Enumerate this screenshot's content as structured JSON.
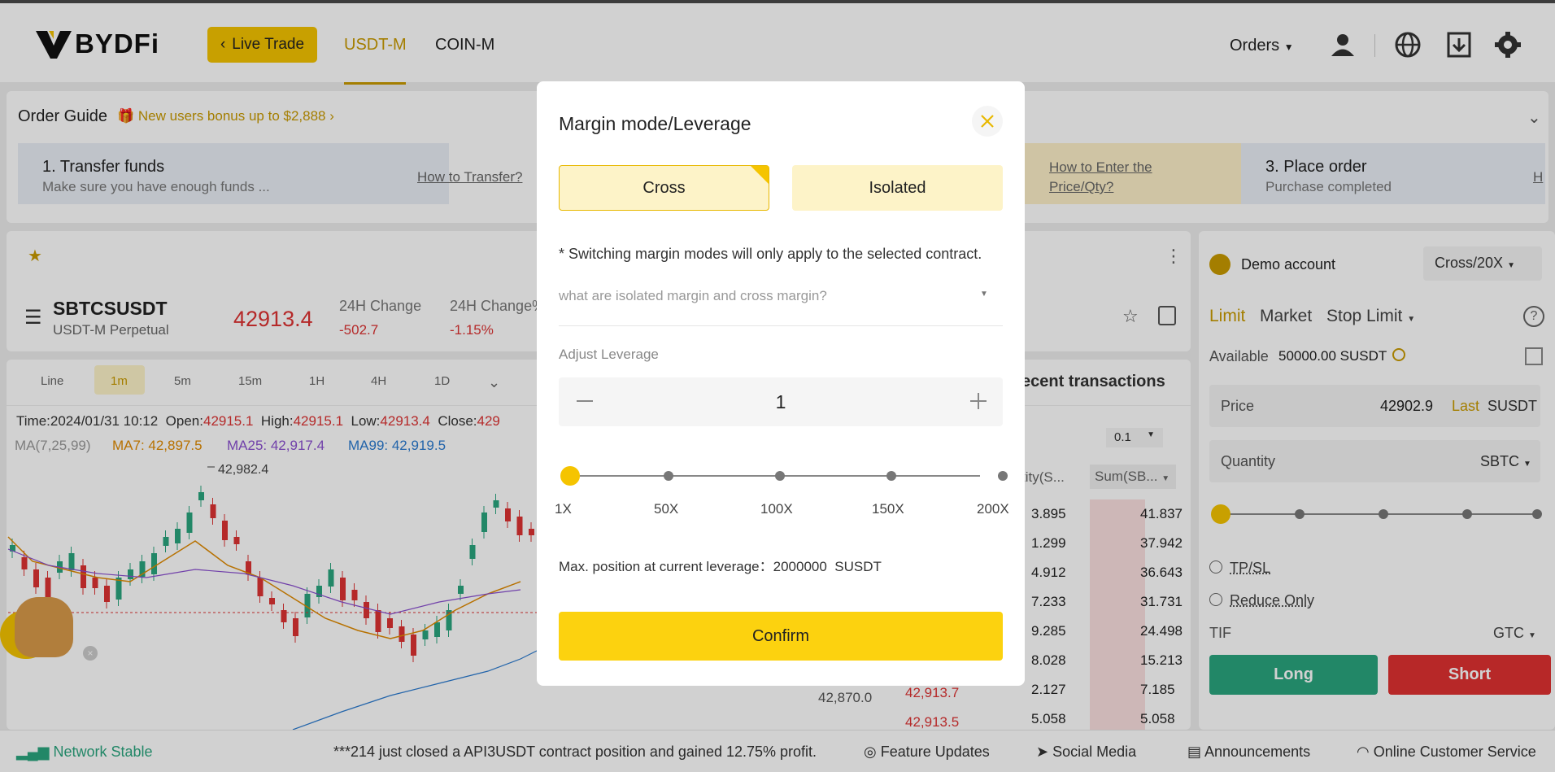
{
  "header": {
    "logo_text": "BYDFi",
    "live_trade": "Live Trade",
    "tabs": [
      "USDT-M",
      "COIN-M"
    ],
    "orders": "Orders"
  },
  "guide": {
    "title": "Order Guide",
    "bonus": "New users bonus up to $2,888",
    "step1_title": "1. Transfer funds",
    "step1_sub": "Make sure you have enough funds ...",
    "step1_link": "How to Transfer?",
    "step2_link_a": "How to Enter the",
    "step2_link_b": "Price/Qty?",
    "step3_title": "3. Place order",
    "step3_sub": "Purchase completed",
    "step3_link": "H"
  },
  "ticker": {
    "symbol": "SBTCSUSDT",
    "sub": "USDT-M Perpetual",
    "price": "42913.4",
    "change_label": "24H Change",
    "change_value": "-502.7",
    "change_pct_label": "24H Change%",
    "change_pct_value": "-1.15%"
  },
  "chart_tabs": [
    "Line",
    "1m",
    "5m",
    "15m",
    "1H",
    "4H",
    "1D"
  ],
  "ohlc": {
    "time": "Time:2024/01/31 10:12",
    "open_label": "Open:",
    "open": "42915.1",
    "high_label": "High:",
    "high": "42915.1",
    "low_label": "Low:",
    "low": "42913.4",
    "close_label": "Close:",
    "close": "429"
  },
  "ma": {
    "params": "MA(7,25,99)",
    "ma7": "MA7: 42,897.5",
    "ma25": "MA25: 42,917.4",
    "ma99": "MA99: 42,919.5"
  },
  "chart_peak": "42,982.4",
  "book": {
    "title": "ecent transactions",
    "step": "0.1",
    "col_qty": "tity(S...",
    "col_sum": "Sum(SB...",
    "qty": [
      "3.895",
      "1.299",
      "4.912",
      "7.233",
      "9.285",
      "8.028",
      "2.127",
      "5.058"
    ],
    "sum": [
      "41.837",
      "37.942",
      "36.643",
      "31.731",
      "24.498",
      "15.213",
      "7.185",
      "5.058"
    ],
    "prices": [
      "42,913.7",
      "42,913.5"
    ],
    "mid": "42,870.0"
  },
  "right": {
    "account": "Demo account",
    "mode": "Cross/20X",
    "order_types": [
      "Limit",
      "Market",
      "Stop Limit"
    ],
    "available_label": "Available",
    "available_value": "50000.00 SUSDT",
    "price_label": "Price",
    "price_value": "42902.9",
    "price_last": "Last",
    "price_unit": "SUSDT",
    "qty_label": "Quantity",
    "qty_unit": "SBTC",
    "tpsl": "TP/SL",
    "reduce": "Reduce Only",
    "tif_label": "TIF",
    "tif_value": "GTC",
    "long": "Long",
    "short": "Short"
  },
  "footer": {
    "network": "Network Stable",
    "ticker_msg": "***214 just closed a API3USDT contract position and gained 12.75% profit.",
    "feature": "Feature Updates",
    "social": "Social Media",
    "announce": "Announcements",
    "service": "Online Customer Service"
  },
  "modal": {
    "title": "Margin mode/Leverage",
    "cross": "Cross",
    "isolated": "Isolated",
    "note": "* Switching margin modes will only apply to the selected contract.",
    "question": "what are isolated margin and cross margin?",
    "adjust": "Adjust Leverage",
    "leverage_value": "1",
    "ticks": [
      "1X",
      "50X",
      "100X",
      "150X",
      "200X"
    ],
    "max_label": "Max. position at current leverage：",
    "max_value": "2000000",
    "max_unit": "SUSDT",
    "confirm": "Confirm"
  },
  "colors": {
    "brand": "#f5c400",
    "up": "#2aa57e",
    "down": "#e03131"
  }
}
